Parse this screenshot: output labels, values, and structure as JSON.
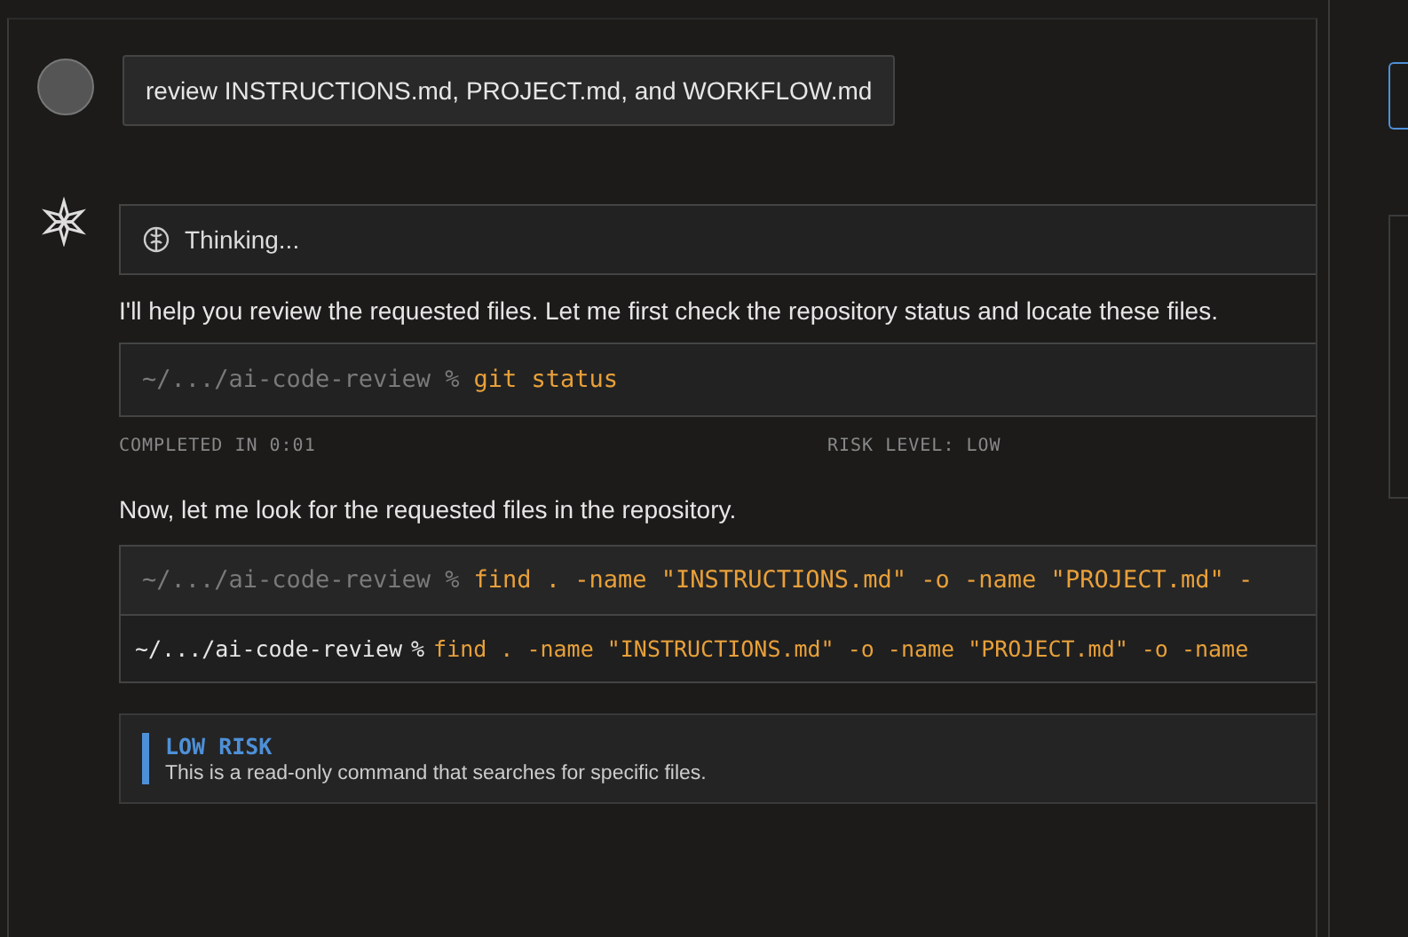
{
  "user_message": {
    "text": "review INSTRUCTIONS.md, PROJECT.md, and WORKFLOW.md"
  },
  "assistant": {
    "thinking": {
      "label": "Thinking..."
    },
    "intro": "I'll help you review the requested files. Let me first check the repository status and locate these files.",
    "command_1": {
      "path": "~/.../ai-code-review",
      "prompt": "%",
      "command": "git status",
      "completed": "COMPLETED IN 0:01",
      "risk": "RISK LEVEL: LOW"
    },
    "followup": "Now, let me look for the requested files in the repository.",
    "command_2": {
      "path": "~/.../ai-code-review",
      "prompt": "%",
      "command": "find . -name \"INSTRUCTIONS.md\" -o -name \"PROJECT.md\" -",
      "output_path": "~/.../ai-code-review",
      "output_prompt": "%",
      "output_command": "find . -name \"INSTRUCTIONS.md\" -o -name \"PROJECT.md\" -o -name"
    },
    "risk_note": {
      "title": "LOW RISK",
      "text": "This is a read-only command that searches for specific files."
    }
  }
}
